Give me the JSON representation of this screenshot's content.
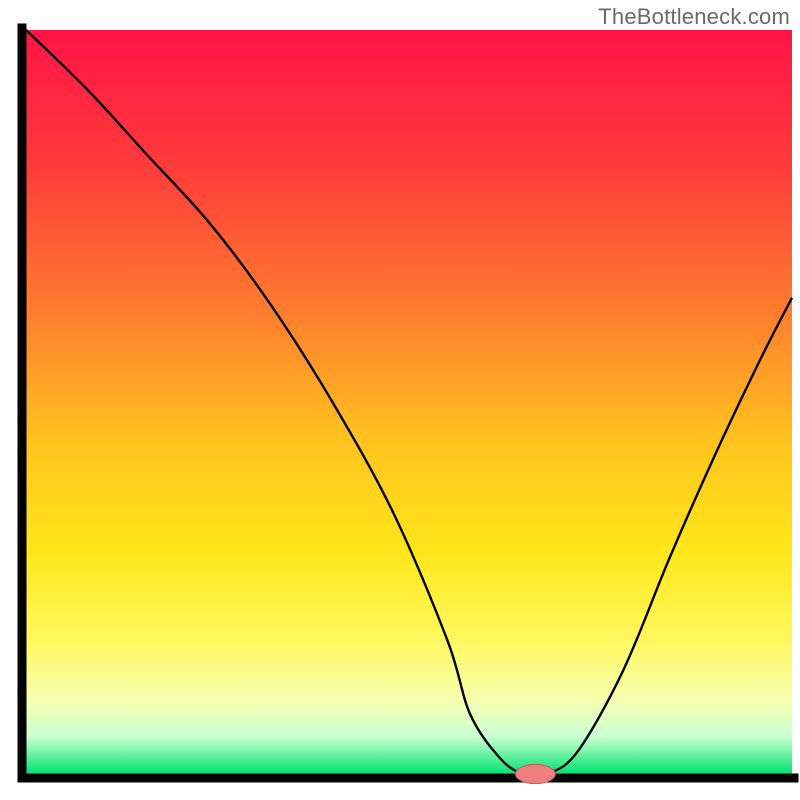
{
  "watermark": "TheBottleneck.com",
  "colors": {
    "axis": "#000000",
    "curve": "#000000",
    "marker_fill": "#f08080",
    "marker_stroke": "#c05a5a",
    "gradient_stops": [
      {
        "offset": 0.0,
        "color": "#ff1447"
      },
      {
        "offset": 0.18,
        "color": "#ff3b3b"
      },
      {
        "offset": 0.38,
        "color": "#ff7d2e"
      },
      {
        "offset": 0.55,
        "color": "#ffc21f"
      },
      {
        "offset": 0.7,
        "color": "#ffe61a"
      },
      {
        "offset": 0.82,
        "color": "#fff75e"
      },
      {
        "offset": 0.9,
        "color": "#f6ffb0"
      },
      {
        "offset": 0.95,
        "color": "#caffd1"
      },
      {
        "offset": 1.0,
        "color": "#00e371"
      }
    ]
  },
  "chart_data": {
    "type": "line",
    "title": "",
    "xlabel": "",
    "ylabel": "",
    "xlim": [
      0,
      100
    ],
    "ylim": [
      0,
      100
    ],
    "x": [
      0,
      8,
      16,
      24,
      32,
      40,
      48,
      55,
      58,
      62,
      65,
      68,
      72,
      78,
      84,
      90,
      96,
      100
    ],
    "values": [
      100,
      92,
      83,
      74,
      63,
      50,
      35,
      18,
      8,
      2,
      0,
      0,
      3,
      14,
      29,
      43,
      56,
      64
    ],
    "marker": {
      "x": 66.5,
      "y": 0,
      "rx": 2.6,
      "ry": 1.3
    },
    "notes": "V-shaped bottleneck curve over vertical heat gradient; optimum at x≈66 where value=0 (green zone)."
  }
}
